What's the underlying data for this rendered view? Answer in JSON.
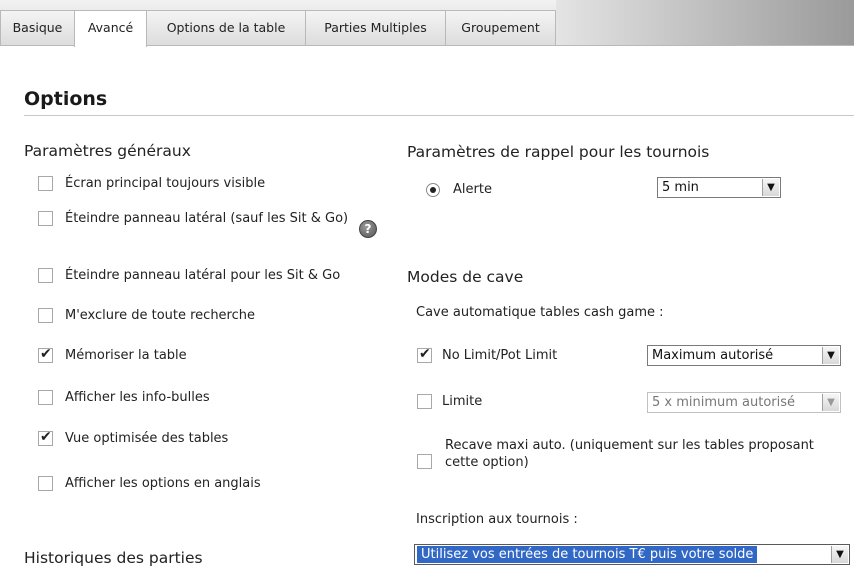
{
  "tabs": [
    {
      "label": "Basique"
    },
    {
      "label": "Avancé"
    },
    {
      "label": "Options de la table"
    },
    {
      "label": "Parties Multiples"
    },
    {
      "label": "Groupement"
    }
  ],
  "page": {
    "title": "Options"
  },
  "general": {
    "heading": "Paramètres généraux",
    "options": [
      {
        "label": "Écran principal toujours visible",
        "checked": false
      },
      {
        "label": "Éteindre panneau latéral (sauf les Sit & Go)",
        "checked": false
      },
      {
        "label": "Éteindre panneau latéral pour les Sit & Go",
        "checked": false
      },
      {
        "label": "M'exclure de toute recherche",
        "checked": false
      },
      {
        "label": "Mémoriser la table",
        "checked": true
      },
      {
        "label": "Afficher les info-bulles",
        "checked": false
      },
      {
        "label": "Vue optimisée des tables",
        "checked": true
      },
      {
        "label": "Afficher les options en anglais",
        "checked": false
      }
    ],
    "help_glyph": "?"
  },
  "reminder": {
    "heading": "Paramètres de rappel pour les tournois",
    "radio_label": "Alerte",
    "select_value": "5 min"
  },
  "buyin": {
    "heading": "Modes de cave",
    "subheading": "Cave automatique tables cash game :",
    "no_limit": {
      "label": "No Limit/Pot Limit",
      "checked": true,
      "select_value": "Maximum autorisé"
    },
    "limit": {
      "label": "Limite",
      "checked": false,
      "select_value": "5 x minimum autorisé"
    },
    "rebuy": {
      "label": "Recave maxi auto. (uniquement sur les tables proposant cette option)",
      "checked": false
    },
    "tournament_label": "Inscription aux tournois :",
    "tournament_select": "Utilisez vos entrées de tournois T€ puis votre solde"
  },
  "history": {
    "heading": "Historiques des parties"
  },
  "icons": {
    "dropdown": "▼",
    "help": "help-icon"
  }
}
